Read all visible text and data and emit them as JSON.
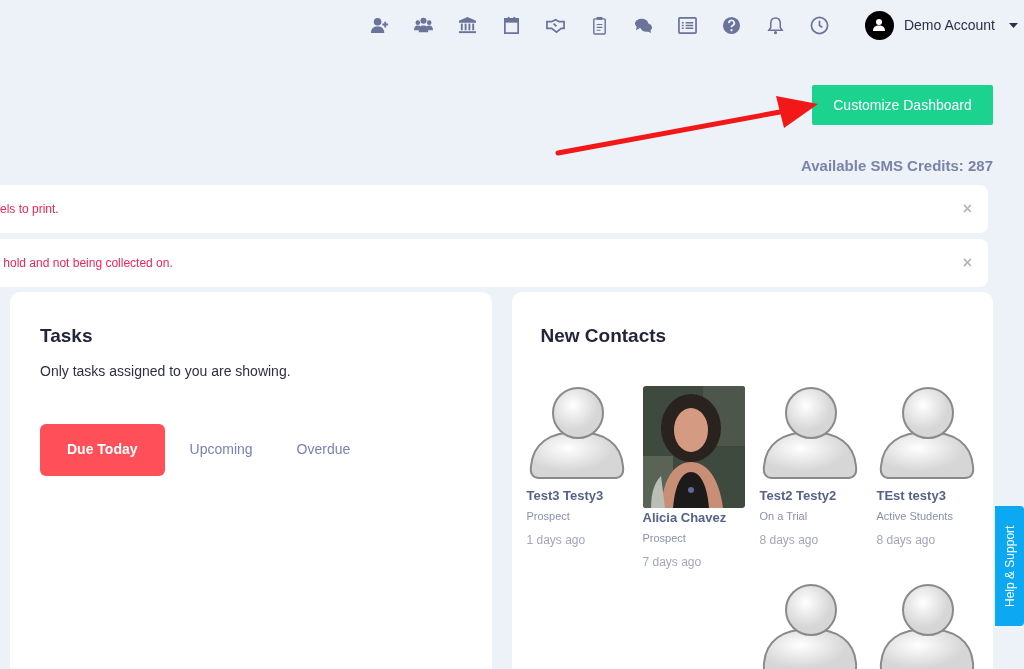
{
  "topbar": {
    "icons": [
      {
        "kind": "user-plus"
      },
      {
        "kind": "users"
      },
      {
        "kind": "bank"
      },
      {
        "kind": "calendar"
      },
      {
        "kind": "handshake"
      },
      {
        "kind": "clipboard"
      },
      {
        "kind": "chat"
      },
      {
        "kind": "list"
      },
      {
        "kind": "help"
      },
      {
        "kind": "bell"
      },
      {
        "kind": "clock"
      }
    ],
    "account": "Demo Account"
  },
  "customize_button": "Customize Dashboard",
  "sms_credits": "Available SMS Credits: 287",
  "alerts": [
    {
      "text": "els to print.",
      "close": "×"
    },
    {
      "text": " hold and not being collected on.",
      "close": "×"
    }
  ],
  "tasks": {
    "title": "Tasks",
    "note": "Only tasks assigned to you are showing.",
    "tabs": [
      {
        "label": "Due Today",
        "selected": true
      },
      {
        "label": "Upcoming",
        "selected": false
      },
      {
        "label": "Overdue",
        "selected": false
      }
    ]
  },
  "new_contacts": {
    "title": "New Contacts",
    "contacts": [
      {
        "kind": "avatar",
        "name": "Test3 Testy3",
        "status": "Prospect",
        "time": "1 days ago"
      },
      {
        "kind": "picture",
        "name": "Alicia Chavez",
        "status": "Prospect",
        "time": "7 days ago"
      },
      {
        "kind": "avatar",
        "name": "Test2 Testy2",
        "status": "On a Trial",
        "time": "8 days ago"
      },
      {
        "kind": "avatar",
        "name": "TEst testy3",
        "status": "Active Students",
        "time": "8 days ago"
      },
      {
        "kind": "avatar"
      },
      {
        "kind": "avatar"
      }
    ]
  },
  "help_tab": "Help & Support"
}
